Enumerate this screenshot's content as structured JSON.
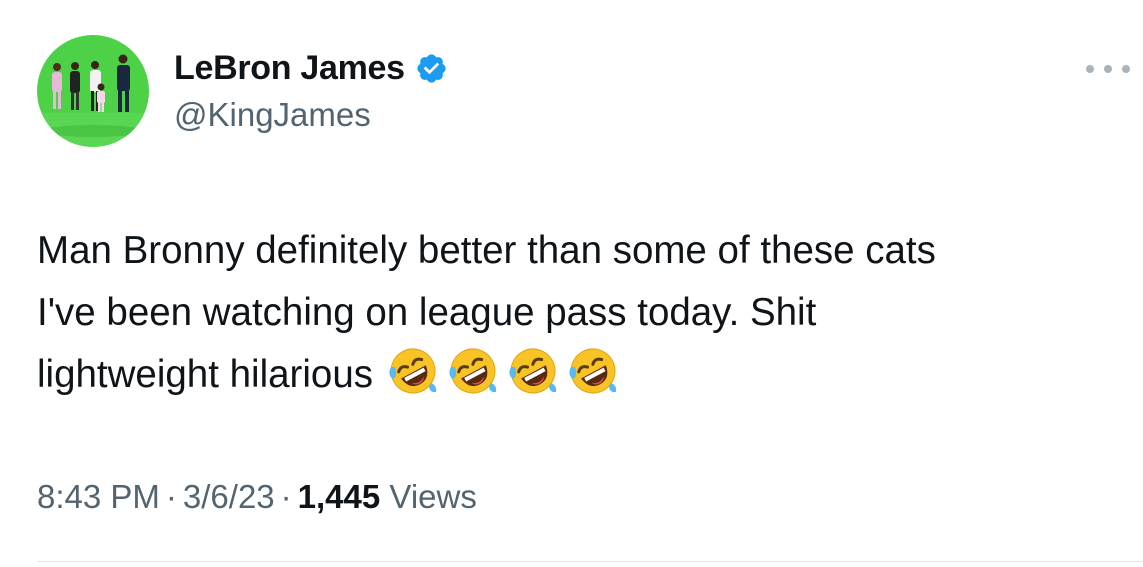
{
  "author": {
    "display_name": "LeBron James",
    "handle": "@KingJames",
    "verified_icon": "verified-badge-icon",
    "avatar_icon": "profile-photo"
  },
  "tweet": {
    "lines": [
      "Man Bronny definitely better than some of these cats",
      "I've been watching on league pass today.  Shit",
      "lightweight hilarious"
    ],
    "emoji_count": 4,
    "emoji_name": "rolling-on-the-floor-laughing-emoji"
  },
  "meta": {
    "time": "8:43 PM",
    "separator": "·",
    "date": "3/6/23",
    "views_count": "1,445",
    "views_label": "Views"
  },
  "colors": {
    "text": "#0f1419",
    "secondary": "#536471",
    "verified": "#1d9bf0",
    "avatar_background": "#4cd147"
  },
  "icons": {
    "more": "more-options-icon"
  }
}
